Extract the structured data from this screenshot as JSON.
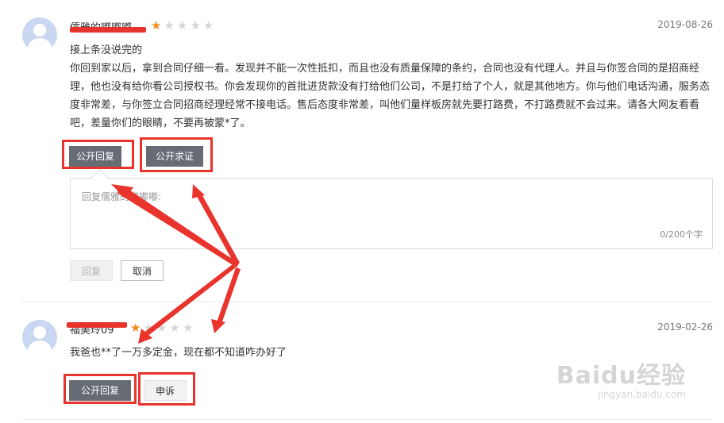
{
  "reviews": [
    {
      "username": "儒雅的嘟嘟嘟",
      "rating": 1,
      "max_rating": 5,
      "date": "2019-08-26",
      "text_line1": "接上条没说完的",
      "text_body": "你回到家以后，拿到合同仔细一看。发现并不能一次性抵扣，而且也没有质量保障的条约，合同也没有代理人。并且与你签合同的是招商经理，他也没有给你看公司授权书。你会发现你的首批进货款没有打给他们公司，不是打给了个人，就是其他地方。你与他们电话沟通，服务态度非常差，与你签立合同招商经理经常不接电话。售后态度非常差，叫他们量样板房就先要打路费，不打路费就不会过来。请各大网友看看吧，差量你们的眼睛，不要再被蒙*了。",
      "actions": [
        "公开回复",
        "公开求证"
      ]
    },
    {
      "username": "福美玲09",
      "rating": 1,
      "max_rating": 5,
      "date": "2019-02-26",
      "text_line1": "我爸也**了一万多定金，现在都不知道咋办好了",
      "actions": [
        "公开回复",
        "申诉"
      ]
    }
  ],
  "reply_form": {
    "placeholder": "回复儒雅的嘟嘟嘟:",
    "counter": "0/200个字",
    "submit_label": "回复",
    "cancel_label": "取消"
  },
  "watermark": {
    "logo": "Baidu经验",
    "url": "jingyan.baidu.com"
  },
  "colors": {
    "accent_red": "#e8342c",
    "star_on": "#f28c1c",
    "star_off": "#d6d6d6",
    "dark_button": "#666b74"
  }
}
